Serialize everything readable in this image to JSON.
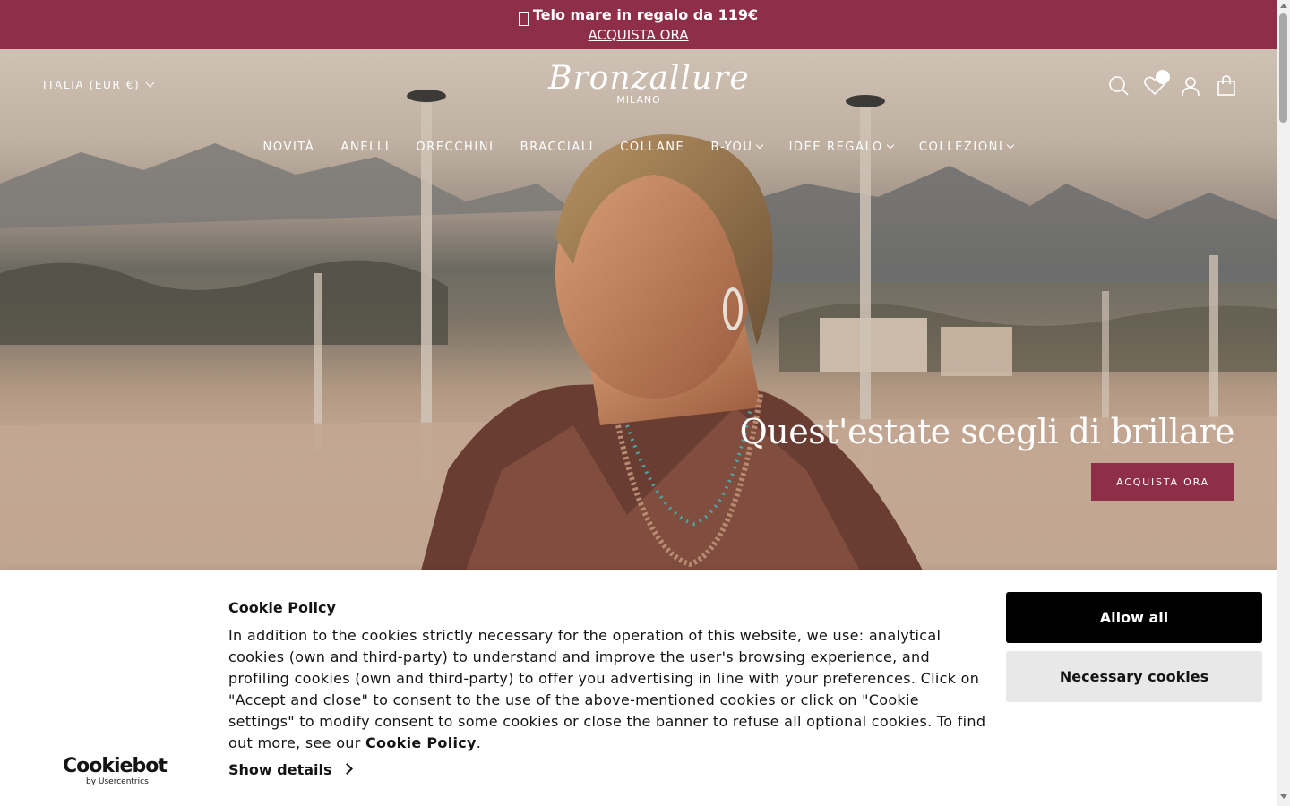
{
  "announcement": {
    "text": "Telo mare in regalo da 119€",
    "link": "ACQUISTA ORA",
    "background": "#8e2e49"
  },
  "header": {
    "country_selector": "ITALIA (EUR €)",
    "logo": {
      "wordmark": "Bronzallure",
      "sub": "MILANO"
    },
    "icons": [
      "search-icon",
      "wishlist-heart-icon",
      "account-icon",
      "cart-bag-icon"
    ]
  },
  "nav": {
    "items": [
      "NOVITÀ",
      "ANELLI",
      "ORECCHINI",
      "BRACCIALI",
      "COLLANE",
      "B-YOU",
      "IDEE REGALO",
      "COLLEZIONI"
    ]
  },
  "hero": {
    "headline": "Quest'estate scegli di brillare",
    "cta": "ACQUISTA ORA",
    "accent": "#8e2e49"
  },
  "cookie": {
    "brand": "Cookiebot",
    "brand_sub": "by Usercentrics",
    "title": "Cookie Policy",
    "body": "In addition to the cookies strictly necessary for the operation of this website, we use: analytical cookies (own and third-party) to understand and improve the user's browsing experience, and profiling cookies (own and third-party) to offer you advertising in line with your preferences. Click on \"Accept and close\" to consent to the use of the above-mentioned cookies or click on \"Cookie settings\" to modify consent to some cookies or close the banner to refuse all optional cookies. To find out more, see our",
    "policy_link": "Cookie Policy",
    "show_details": "Show details",
    "allow_all": "Allow all",
    "necessary": "Necessary cookies"
  }
}
